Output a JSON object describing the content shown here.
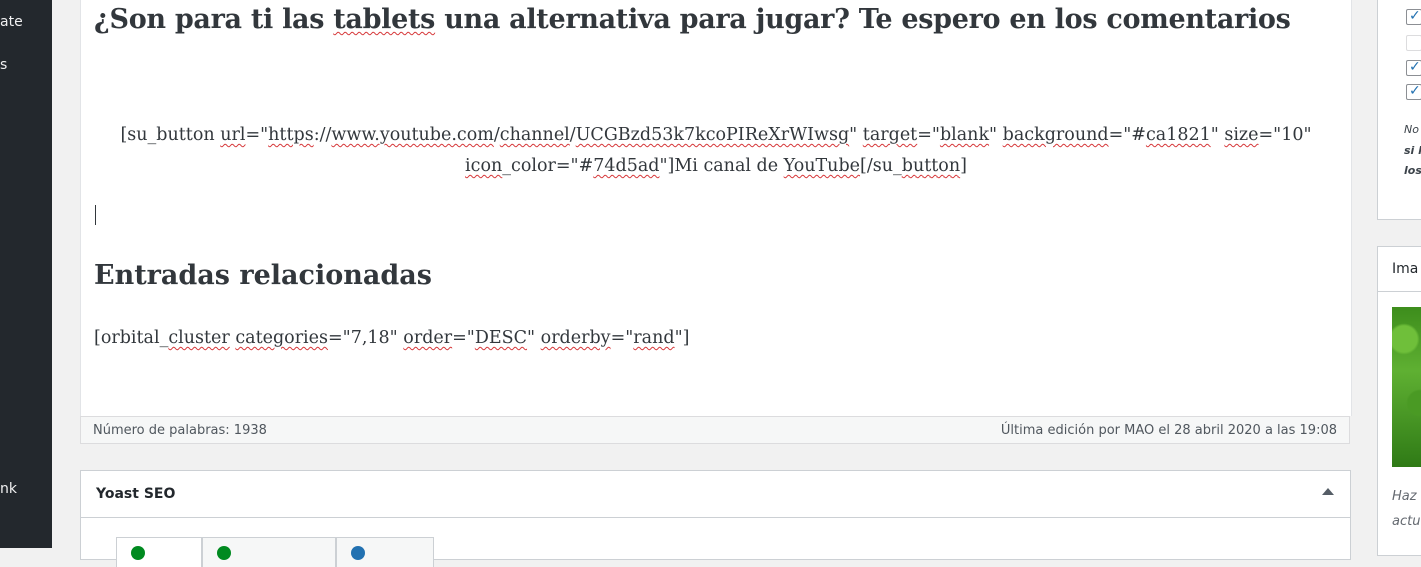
{
  "sidebar": {
    "items": [
      {
        "label": "ate"
      },
      {
        "label": "s"
      },
      {
        "label": "nk"
      }
    ]
  },
  "editor": {
    "heading_question": [
      {
        "text": "¿Son para ti las "
      },
      {
        "text": "tablets",
        "misspelled": true
      },
      {
        "text": " una alternativa para jugar? Te espero en los comentarios"
      }
    ],
    "shortcode_button": [
      {
        "text": "[su_button "
      },
      {
        "text": "url",
        "misspelled": true
      },
      {
        "text": "=\""
      },
      {
        "text": "https",
        "misspelled": true
      },
      {
        "text": "://"
      },
      {
        "text": "www.youtube.com",
        "misspelled": true
      },
      {
        "text": "/"
      },
      {
        "text": "channel",
        "misspelled": true
      },
      {
        "text": "/"
      },
      {
        "text": "UCGBzd53k7kcoPIReXrWIwsg",
        "misspelled": true
      },
      {
        "text": "\" "
      },
      {
        "text": "target",
        "misspelled": true
      },
      {
        "text": "=\""
      },
      {
        "text": "blank",
        "misspelled": true
      },
      {
        "text": "\" "
      },
      {
        "text": "background",
        "misspelled": true
      },
      {
        "text": "=\"#"
      },
      {
        "text": "ca1821",
        "misspelled": true
      },
      {
        "text": "\" "
      },
      {
        "text": "size",
        "misspelled": true
      },
      {
        "text": "=\"10\" "
      },
      {
        "text": "icon",
        "misspelled": true
      },
      {
        "text": "_color=\"#"
      },
      {
        "text": "74d5ad",
        "misspelled": true
      },
      {
        "text": "\"]Mi canal de "
      },
      {
        "text": "YouTube",
        "misspelled": true
      },
      {
        "text": "[/su_"
      },
      {
        "text": "button",
        "misspelled": true
      },
      {
        "text": "]"
      }
    ],
    "heading_related": "Entradas relacionadas",
    "shortcode_cluster": [
      {
        "text": "[orbital_"
      },
      {
        "text": "cluster",
        "misspelled": true
      },
      {
        "text": " "
      },
      {
        "text": "categories",
        "misspelled": true
      },
      {
        "text": "=\"7,18\" "
      },
      {
        "text": "order",
        "misspelled": true
      },
      {
        "text": "=\""
      },
      {
        "text": "DESC",
        "misspelled": true
      },
      {
        "text": "\" "
      },
      {
        "text": "orderby",
        "misspelled": true
      },
      {
        "text": "=\""
      },
      {
        "text": "rand",
        "misspelled": true
      },
      {
        "text": "\"]"
      }
    ]
  },
  "statusbar": {
    "word_count": "Número de palabras: 1938",
    "last_edit": "Última edición por MAO el 28 abril 2020 a las 19:08"
  },
  "yoast": {
    "title": "Yoast SEO",
    "tabs": [
      {
        "status_color": "#008a20"
      },
      {
        "status_color": "#008a20"
      },
      {
        "status_color": "#2271b1"
      }
    ]
  },
  "right_panel": {
    "checkboxes": [
      {
        "checked": true
      },
      {
        "checked": false
      },
      {
        "checked": true
      },
      {
        "checked": true
      }
    ],
    "note_lines": [
      {
        "text": "No",
        "bold": false
      },
      {
        "text": "si l",
        "bold": true
      },
      {
        "text": "los",
        "bold": true
      }
    ],
    "image_box": {
      "title": "Ima",
      "hint_lines": [
        "Haz",
        "actu"
      ]
    }
  }
}
